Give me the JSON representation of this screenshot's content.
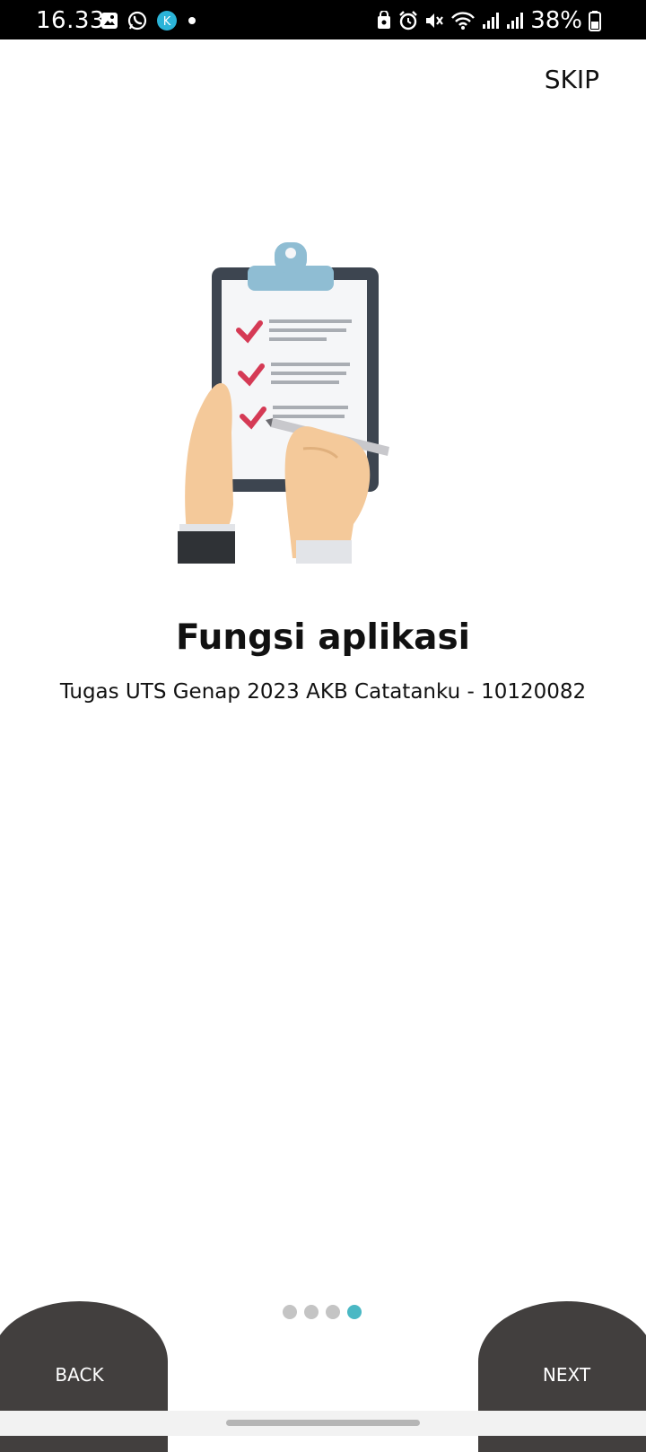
{
  "status_bar": {
    "time": "16.33",
    "battery_percent": "38%",
    "left_icons": [
      "gallery-icon",
      "whatsapp-icon",
      "app-notification-icon",
      "dot-icon"
    ],
    "right_icons": [
      "lock-save-icon",
      "alarm-icon",
      "mute-icon",
      "wifi-icon",
      "signal-icon",
      "signal-icon",
      "battery-icon"
    ]
  },
  "header": {
    "skip_label": "SKIP"
  },
  "onboarding": {
    "title": "Fungsi aplikasi",
    "subtitle": "Tugas UTS Genap 2023 AKB Catatanku - 10120082",
    "page_count": 4,
    "active_page": 4
  },
  "footer": {
    "back_label": "BACK",
    "next_label": "NEXT"
  },
  "colors": {
    "dot_inactive": "#c4c4c4",
    "dot_active": "#4ab8c4",
    "button_bg": "#423f3e",
    "check": "#d53a55",
    "clip": "#8fbdd3"
  }
}
